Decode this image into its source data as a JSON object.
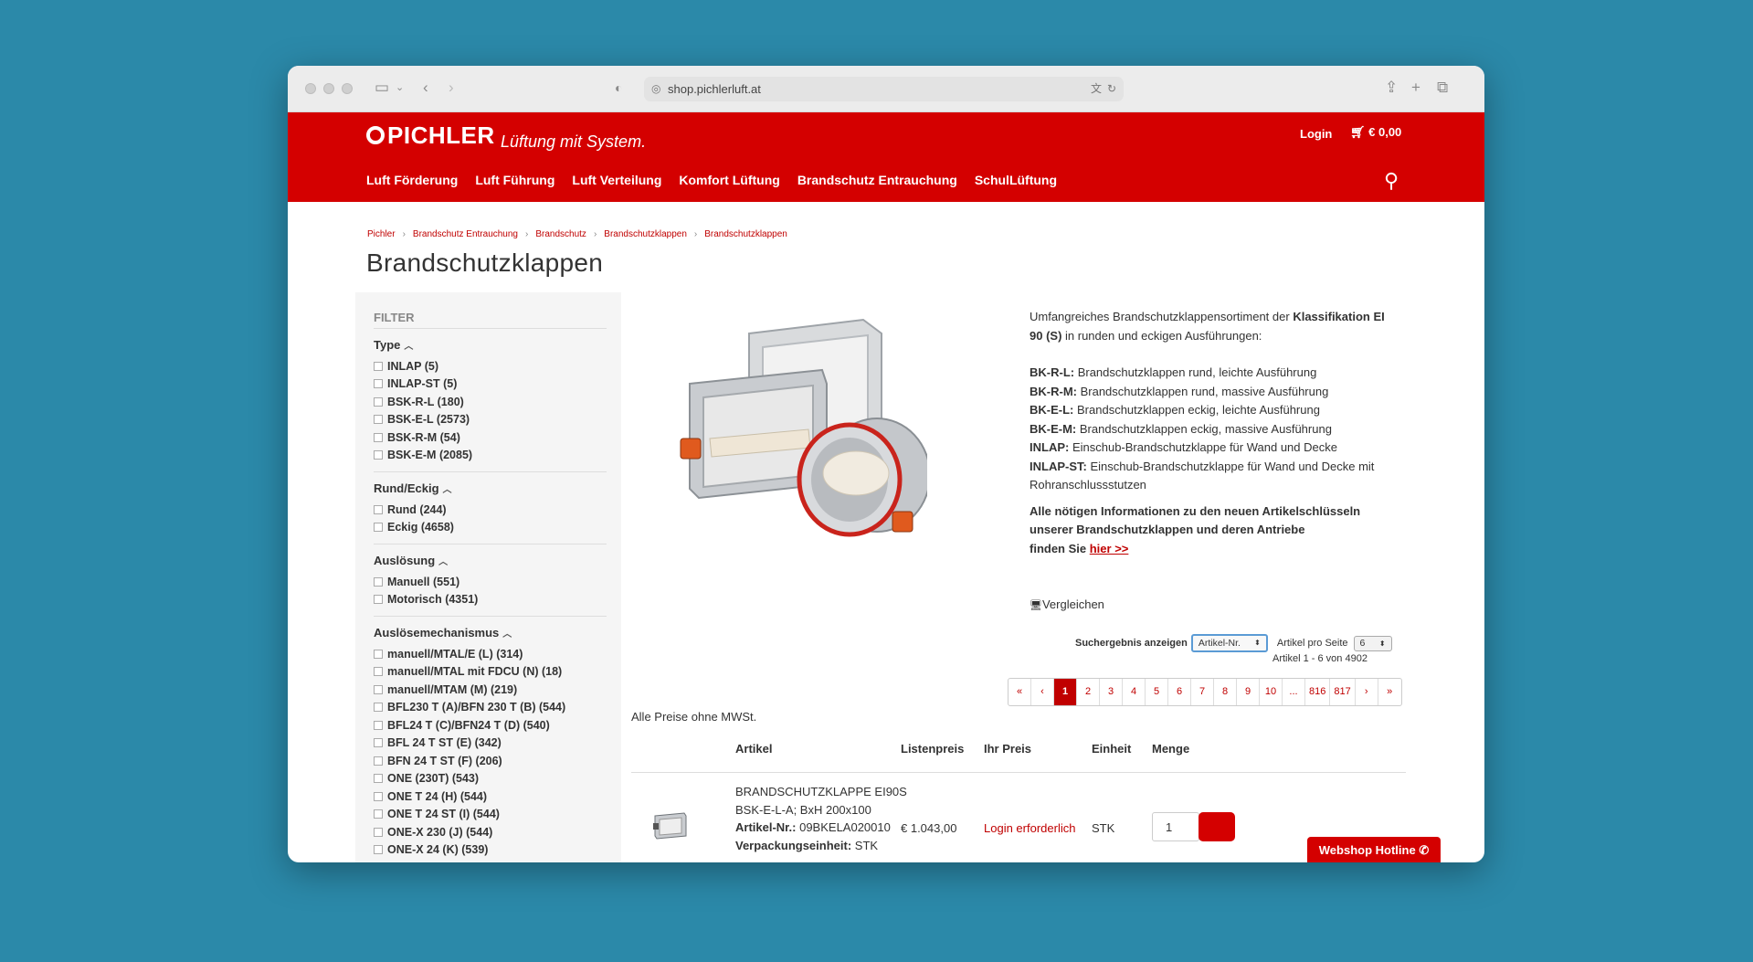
{
  "browser": {
    "url": "shop.pichlerluft.at"
  },
  "header": {
    "logo": "PICHLER",
    "slogan": "Lüftung mit System.",
    "login": "Login",
    "cart_total": "€ 0,00",
    "nav": [
      "Luft Förderung",
      "Luft Führung",
      "Luft Verteilung",
      "Komfort Lüftung",
      "Brandschutz Entrauchung",
      "SchulLüftung"
    ]
  },
  "breadcrumb": [
    "Pichler",
    "Brandschutz Entrauchung",
    "Brandschutz",
    "Brandschutzklappen",
    "Brandschutzklappen"
  ],
  "page_title": "Brandschutzklappen",
  "filter": {
    "title": "FILTER",
    "groups": [
      {
        "title": "Type",
        "items": [
          "INLAP (5)",
          "INLAP-ST (5)",
          "BSK-R-L (180)",
          "BSK-E-L (2573)",
          "BSK-R-M (54)",
          "BSK-E-M (2085)"
        ]
      },
      {
        "title": "Rund/Eckig",
        "items": [
          "Rund (244)",
          "Eckig (4658)"
        ]
      },
      {
        "title": "Auslösung",
        "items": [
          "Manuell (551)",
          "Motorisch (4351)"
        ]
      },
      {
        "title": "Auslösemechanismus",
        "items": [
          "manuell/MTAL/E (L) (314)",
          "manuell/MTAL mit FDCU (N) (18)",
          "manuell/MTAM (M) (219)",
          "BFL230 T (A)/BFN 230 T (B) (544)",
          "BFL24 T (C)/BFN24 T (D) (540)",
          "BFL 24 T ST (E) (342)",
          "BFN 24 T ST (F) (206)",
          "ONE (230T) (543)",
          "ONE T 24 (H) (544)",
          "ONE T 24 ST (I) (544)",
          "ONE-X 230 (J) (544)",
          "ONE-X 24 (K) (539)"
        ]
      }
    ]
  },
  "description": {
    "intro_pre": "Umfangreiches Brandschutzklappensortiment der ",
    "intro_bold": "Klassifikation EI 90 (S)",
    "intro_post": " in runden und eckigen Ausführungen:",
    "types": [
      {
        "code": "BK-R-L:",
        "text": " Brandschutzklappen rund, leichte Ausführung"
      },
      {
        "code": "BK-R-M:",
        "text": " Brandschutzklappen rund, massive Ausführung"
      },
      {
        "code": "BK-E-L:",
        "text": " Brandschutzklappen eckig, leichte Ausführung"
      },
      {
        "code": "BK-E-M:",
        "text": " Brandschutzklappen eckig, massive Ausführung"
      },
      {
        "code": "INLAP:",
        "text": " Einschub-Brandschutzklappe für Wand und Decke"
      },
      {
        "code": "INLAP-ST:",
        "text": " Einschub-Brandschutzklappe für Wand und Decke mit Rohranschlussstutzen"
      }
    ],
    "info_line1": "Alle nötigen Informationen zu den neuen Artikelschlüsseln",
    "info_line2": "unserer Brandschutzklappen und deren Antriebe",
    "info_line3": "finden Sie ",
    "info_link": "hier >>"
  },
  "compare_label": "Vergleichen",
  "sorting": {
    "label": "Suchergebnis anzeigen",
    "sort_value": "Artikel-Nr.",
    "per_page_label": "Artikel pro Seite",
    "per_page_value": "6",
    "count": "Artikel 1 - 6 von 4902"
  },
  "pagination": [
    "«",
    "‹",
    "1",
    "2",
    "3",
    "4",
    "5",
    "6",
    "7",
    "8",
    "9",
    "10",
    "...",
    "816",
    "817",
    "›",
    "»"
  ],
  "prices_note": "Alle Preise ohne MWSt.",
  "table": {
    "headers": {
      "artikel": "Artikel",
      "listenpreis": "Listenpreis",
      "ihr_preis": "Ihr Preis",
      "einheit": "Einheit",
      "menge": "Menge"
    },
    "rows": [
      {
        "name": "BRANDSCHUTZKLAPPE EI90S",
        "variant": "BSK-E-L-A; BxH 200x100",
        "artnr_label": "Artikel-Nr.:",
        "artnr": "09BKELA020010",
        "vpe_label": "Verpackungseinheit:",
        "vpe": "STK",
        "list_price": "€ 1.043,00",
        "your_price": "Login erforderlich",
        "unit": "STK",
        "qty": "1"
      }
    ]
  },
  "hotline": "Webshop Hotline"
}
